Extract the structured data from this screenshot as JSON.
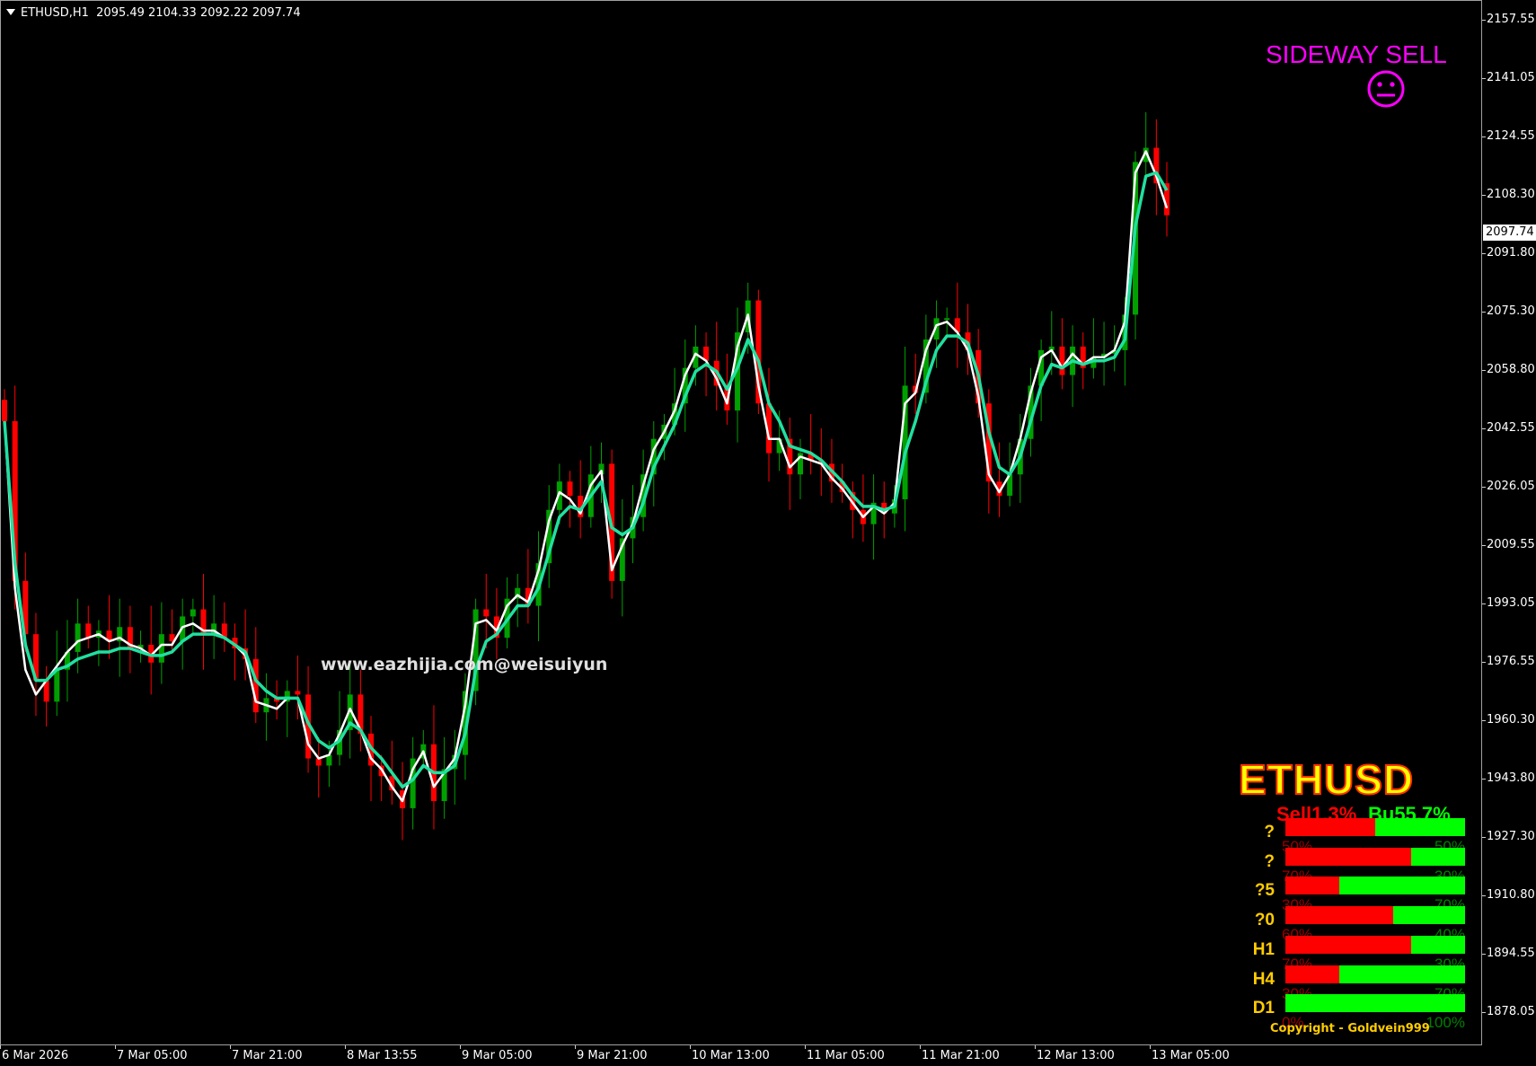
{
  "header": {
    "symbol_tf": "ETHUSD,H1",
    "ohlc": "2095.49 2104.33 2092.22 2097.74"
  },
  "price_axis": {
    "labels": [
      "2157.55",
      "2141.05",
      "2124.55",
      "2108.30",
      "2091.80",
      "2075.30",
      "2058.80",
      "2042.55",
      "2026.05",
      "2009.55",
      "1993.05",
      "1976.55",
      "1960.30",
      "1943.80",
      "1927.30",
      "1910.80",
      "1894.55",
      "1878.05"
    ],
    "current": "2097.74"
  },
  "time_axis": {
    "labels": [
      "6 Mar 2026",
      "7 Mar 05:00",
      "7 Mar 21:00",
      "8 Mar 13:55",
      "9 Mar 05:00",
      "9 Mar 21:00",
      "10 Mar 13:00",
      "11 Mar 05:00",
      "11 Mar 21:00",
      "12 Mar 13:00",
      "13 Mar 05:00"
    ]
  },
  "watermark": "www.eazhijia.com@weisuiyun",
  "signal": {
    "text": "SIDEWAY SELL",
    "icon": "neutral-face-icon",
    "color": "#ff00ff"
  },
  "panel": {
    "title": "ETHUSD",
    "sell_total": "Sell1.3%",
    "buy_total": "Bu55.7%",
    "rows": [
      {
        "label": "?",
        "sell": 0.5,
        "sell_text": "50%",
        "buy_text": "50%"
      },
      {
        "label": "?",
        "sell": 0.7,
        "sell_text": "70%",
        "buy_text": "30%"
      },
      {
        "label": "?5",
        "sell": 0.3,
        "sell_text": "30%",
        "buy_text": "70%"
      },
      {
        "label": "?0",
        "sell": 0.6,
        "sell_text": "60%",
        "buy_text": "40%"
      },
      {
        "label": "H1",
        "sell": 0.7,
        "sell_text": "70%",
        "buy_text": "30%"
      },
      {
        "label": "H4",
        "sell": 0.3,
        "sell_text": "30%",
        "buy_text": "70%"
      },
      {
        "label": "D1",
        "sell": 0.0,
        "sell_text": "0%",
        "buy_text": "100%"
      }
    ],
    "copyright": "Copyright - Goldvein999"
  },
  "colors": {
    "bull": "#00a000",
    "bear": "#ff0000",
    "ma_fast": "#ffffff",
    "ma_slow": "#20e0a0",
    "background": "#000000"
  },
  "chart_data": {
    "type": "candlestick",
    "symbol": "ETHUSD",
    "timeframe": "H1",
    "ylim": [
      1870.0,
      2162.0
    ],
    "close_series": [
      2045,
      2000,
      1985,
      1972,
      1966,
      1975,
      1980,
      1988,
      1984,
      1986,
      1983,
      1987,
      1981,
      1982,
      1977,
      1985,
      1983,
      1990,
      1992,
      1985,
      1988,
      1984,
      1981,
      1978,
      1963,
      1967,
      1966,
      1969,
      1968,
      1950,
      1948,
      1951,
      1958,
      1968,
      1957,
      1948,
      1945,
      1941,
      1936,
      1950,
      1954,
      1938,
      1947,
      1951,
      1969,
      1992,
      1990,
      1984,
      1995,
      1998,
      1993,
      2005,
      2020,
      2028,
      2024,
      2018,
      2030,
      2033,
      2000,
      2012,
      2018,
      2030,
      2040,
      2044,
      2050,
      2060,
      2066,
      2062,
      2055,
      2048,
      2070,
      2079,
      2050,
      2036,
      2040,
      2030,
      2036,
      2034,
      2033,
      2028,
      2025,
      2020,
      2016,
      2022,
      2019,
      2023,
      2055,
      2053,
      2068,
      2074,
      2074,
      2070,
      2065,
      2050,
      2028,
      2024,
      2030,
      2040,
      2055,
      2065,
      2066,
      2058,
      2066,
      2060,
      2063,
      2064,
      2065,
      2075,
      2118,
      2122,
      2112,
      2103
    ],
    "ma_fast_series": [
      2045,
      1998,
      1975,
      1968,
      1972,
      1976,
      1980,
      1983,
      1984,
      1985,
      1983,
      1984,
      1982,
      1981,
      1979,
      1982,
      1982,
      1987,
      1988,
      1986,
      1986,
      1984,
      1982,
      1979,
      1966,
      1965,
      1964,
      1967,
      1967,
      1954,
      1950,
      1951,
      1957,
      1964,
      1958,
      1950,
      1947,
      1942,
      1938,
      1947,
      1952,
      1942,
      1946,
      1950,
      1965,
      1988,
      1989,
      1986,
      1993,
      1996,
      1994,
      2003,
      2017,
      2025,
      2023,
      2019,
      2027,
      2031,
      2003,
      2010,
      2016,
      2027,
      2037,
      2042,
      2048,
      2058,
      2064,
      2062,
      2057,
      2050,
      2066,
      2075,
      2055,
      2040,
      2040,
      2032,
      2035,
      2034,
      2033,
      2029,
      2026,
      2022,
      2018,
      2021,
      2019,
      2022,
      2050,
      2053,
      2065,
      2072,
      2073,
      2070,
      2065,
      2052,
      2030,
      2025,
      2030,
      2040,
      2053,
      2063,
      2065,
      2060,
      2064,
      2061,
      2063,
      2063,
      2065,
      2073,
      2115,
      2121,
      2114,
      2105
    ],
    "ma_slow_series": [
      2045,
      2005,
      1982,
      1972,
      1972,
      1975,
      1976,
      1978,
      1979,
      1980,
      1980,
      1981,
      1981,
      1980,
      1979,
      1979,
      1980,
      1983,
      1985,
      1985,
      1985,
      1984,
      1982,
      1980,
      1972,
      1969,
      1967,
      1967,
      1967,
      1960,
      1955,
      1953,
      1955,
      1960,
      1958,
      1953,
      1950,
      1946,
      1942,
      1944,
      1948,
      1946,
      1946,
      1948,
      1957,
      1975,
      1983,
      1985,
      1989,
      1993,
      1993,
      1998,
      2008,
      2018,
      2021,
      2020,
      2024,
      2028,
      2015,
      2013,
      2015,
      2022,
      2032,
      2038,
      2044,
      2052,
      2059,
      2061,
      2059,
      2054,
      2060,
      2068,
      2062,
      2050,
      2045,
      2038,
      2037,
      2036,
      2034,
      2031,
      2028,
      2024,
      2021,
      2021,
      2020,
      2021,
      2036,
      2045,
      2056,
      2065,
      2069,
      2069,
      2067,
      2058,
      2042,
      2032,
      2030,
      2035,
      2045,
      2055,
      2061,
      2060,
      2062,
      2061,
      2062,
      2062,
      2063,
      2068,
      2100,
      2114,
      2115,
      2110
    ]
  }
}
